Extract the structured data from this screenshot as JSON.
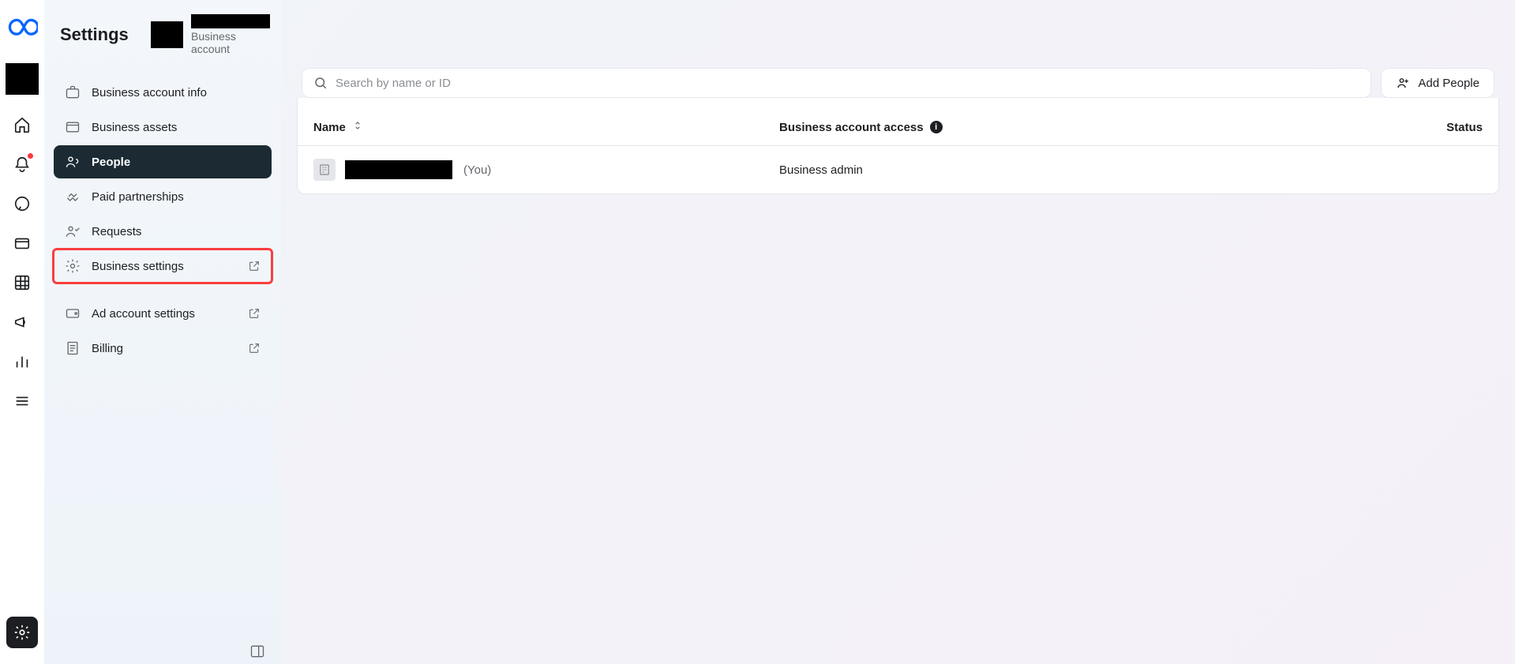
{
  "header": {
    "title": "Settings",
    "account_subtitle": "Business account"
  },
  "sidebar": {
    "items": [
      {
        "label": "Business account info"
      },
      {
        "label": "Business assets"
      },
      {
        "label": "People"
      },
      {
        "label": "Paid partnerships"
      },
      {
        "label": "Requests"
      },
      {
        "label": "Business settings"
      },
      {
        "label": "Ad account settings"
      },
      {
        "label": "Billing"
      }
    ]
  },
  "main": {
    "search_placeholder": "Search by name or ID",
    "add_people_label": "Add People",
    "columns": {
      "name": "Name",
      "access": "Business account access",
      "status": "Status"
    },
    "rows": [
      {
        "you_suffix": "(You)",
        "access": "Business admin",
        "status": ""
      }
    ]
  }
}
